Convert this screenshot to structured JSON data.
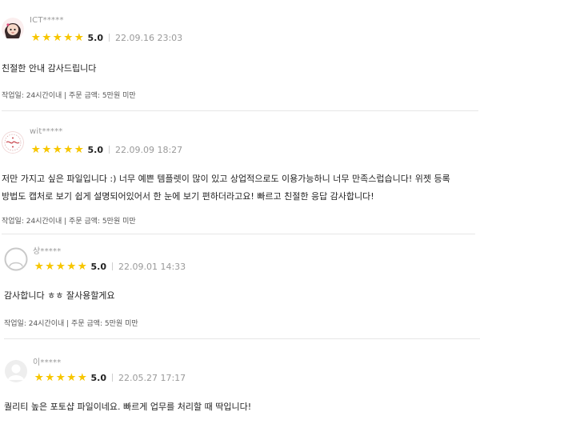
{
  "reviews": [
    {
      "username": "ICT*****",
      "avatar": "character-avatar-icon",
      "score": "5.0",
      "date": "22.09.16 23:03",
      "content": "친절한 안내 감사드립니다",
      "meta": "작업일: 24시간이내 | 주문 금액: 5만원 미만"
    },
    {
      "username": "wit*****",
      "avatar": "brand-logo-avatar-icon",
      "score": "5.0",
      "date": "22.09.09 18:27",
      "content": "저만 가지고 싶은 파일입니다 :) 너무 예쁜 템플렛이 많이 있고 상업적으로도 이용가능하니 너무 만족스럽습니다! 위젯 등록방법도 캡처로 보기 쉽게 설명되어있어서 한 눈에 보기 편하더라고요! 빠르고 친절한 응답 감사합니다!",
      "meta": "작업일: 24시간이내 | 주문 금액: 5만원 미만"
    },
    {
      "username": "상*****",
      "avatar": "default-user-avatar-icon",
      "score": "5.0",
      "date": "22.09.01 14:33",
      "content": "감사합니다 ㅎㅎ 잘사용할게요",
      "meta": "작업일: 24시간이내 | 주문 금액: 5만원 미만"
    },
    {
      "username": "이*****",
      "avatar": "default-user-avatar-icon",
      "score": "5.0",
      "date": "22.05.27 17:17",
      "content": "퀄리티 높은 포토샵 파일이네요. 빠르게 업무를 처리할 때 딱입니다!",
      "meta": ""
    }
  ],
  "star_glyph": "★",
  "colors": {
    "star": "#f7c600",
    "muted": "#9a9a9a",
    "divider": "#e6e6e6"
  }
}
